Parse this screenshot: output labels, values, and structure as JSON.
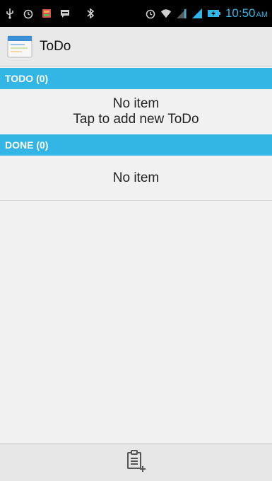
{
  "status_bar": {
    "time": "10:50",
    "ampm": "AM",
    "icons": [
      "usb-icon",
      "alarm-icon",
      "notification-app-icon",
      "chat-icon",
      "bluetooth-icon",
      "alarm-icon",
      "wifi-icon",
      "signal-icon",
      "signal-icon",
      "battery-charging-icon"
    ],
    "accent": "#33b5e5"
  },
  "action_bar": {
    "title": "ToDo",
    "icon": "todo-app-icon"
  },
  "todo_section": {
    "header": "TODO (0)",
    "line1": "No item",
    "line2": "Tap to add new ToDo"
  },
  "done_section": {
    "header": "DONE (0)",
    "line1": "No item"
  },
  "bottom_bar": {
    "action_icon": "add-todo-icon"
  },
  "colors": {
    "section_header_bg": "#33b5e5",
    "background": "#f1f1f1"
  }
}
